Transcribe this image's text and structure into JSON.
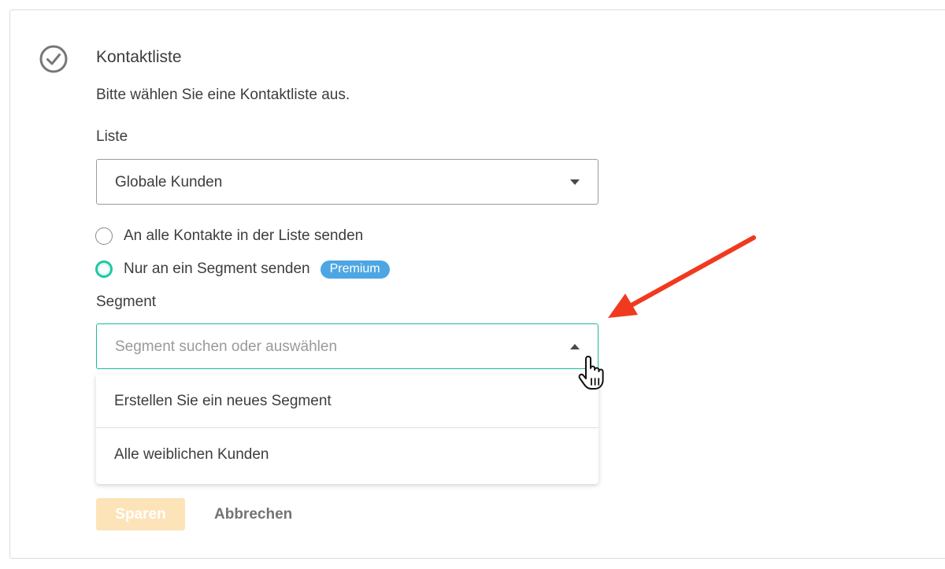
{
  "section": {
    "title": "Kontaktliste",
    "description": "Bitte wählen Sie eine Kontaktliste aus."
  },
  "list_field": {
    "label": "Liste",
    "selected_value": "Globale Kunden"
  },
  "send_options": {
    "option_all": {
      "label": "An alle Kontakte in der Liste senden",
      "checked": false
    },
    "option_segment": {
      "label": "Nur an ein Segment senden",
      "checked": true,
      "badge": "Premium"
    }
  },
  "segment_field": {
    "label": "Segment",
    "placeholder": "Segment suchen oder auswählen",
    "options": [
      {
        "label": "Erstellen Sie ein neues Segment"
      },
      {
        "label": "Alle weiblichen Kunden"
      }
    ]
  },
  "actions": {
    "save_label": "Sparen",
    "cancel_label": "Abbrechen"
  },
  "colors": {
    "accent_teal": "#21c7a3",
    "badge_blue": "#4da6e3",
    "save_disabled": "#fde3b8",
    "annotation_red": "#f03a1f"
  },
  "icons": {
    "section_status": "check-circle-icon",
    "cursor": "hand-pointer-icon",
    "annotation": "red-arrow-icon"
  }
}
